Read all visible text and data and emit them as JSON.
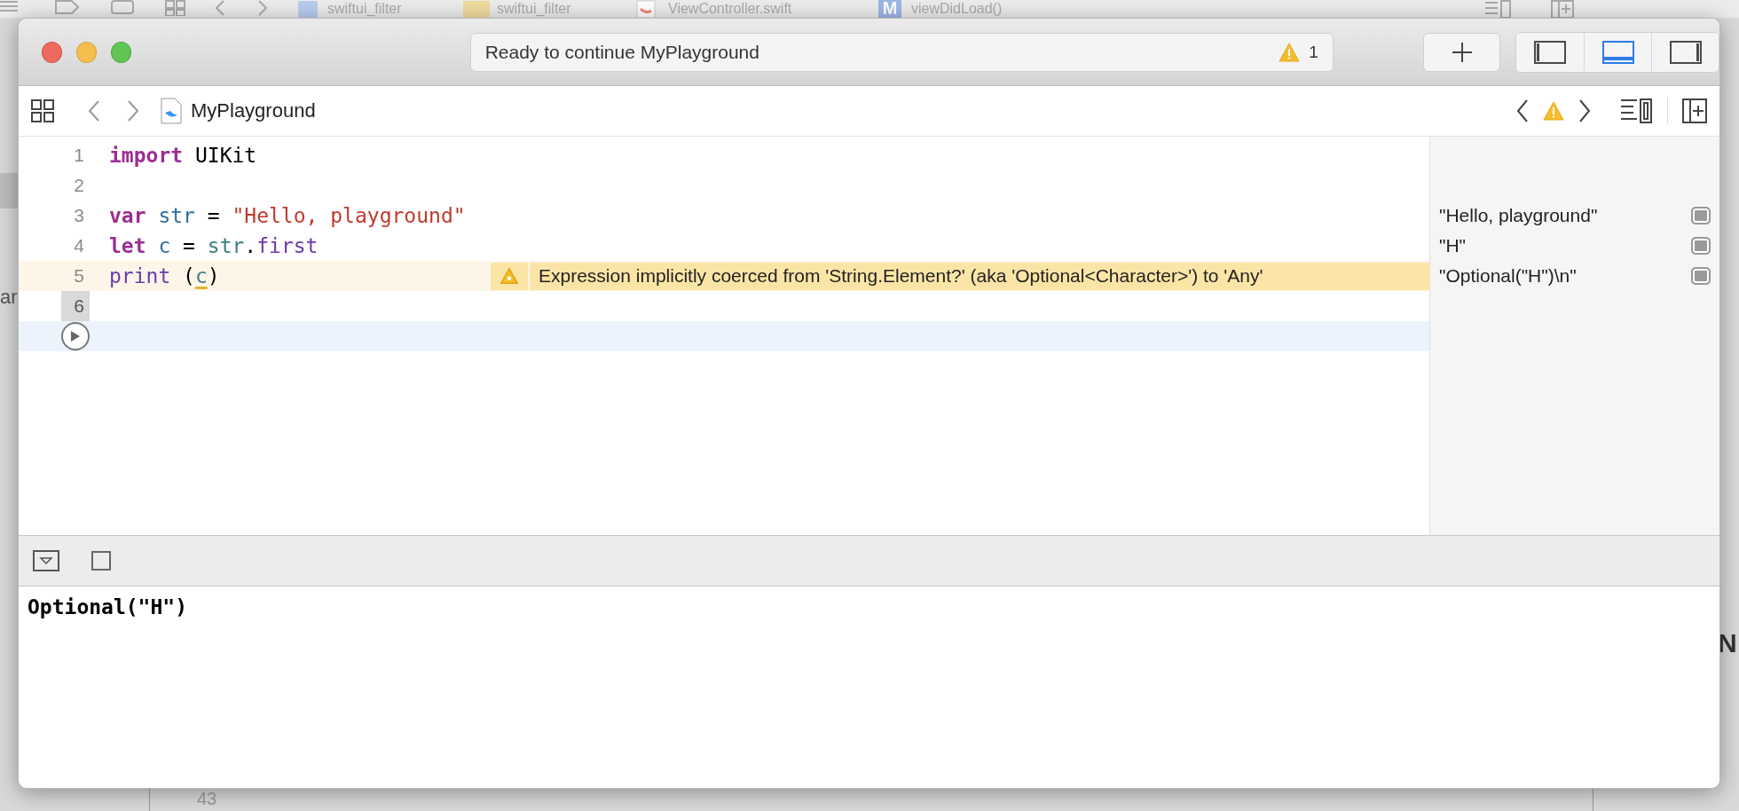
{
  "background": {
    "breadcrumbs": [
      "swiftui_filter",
      "swiftui_filter",
      "ViewController.swift",
      "viewDidLoad()"
    ],
    "method_badge": "M",
    "side_text": "ar",
    "line_number": "43",
    "edge_text": "N"
  },
  "window": {
    "status": "Ready to continue MyPlayground",
    "warning_count": "1",
    "panels": [
      {
        "selected": false
      },
      {
        "selected": true
      },
      {
        "selected": false
      }
    ]
  },
  "jump_bar": {
    "title": "MyPlayground"
  },
  "editor": {
    "lines": [
      {
        "kind": "code",
        "number": "1",
        "selected": false,
        "current": false,
        "tokens": [
          {
            "kind": "keyword",
            "text": "import"
          },
          {
            "kind": "plain",
            "text": " UIKit"
          }
        ]
      },
      {
        "kind": "code",
        "number": "2",
        "selected": false,
        "current": false
      },
      {
        "kind": "code",
        "number": "3",
        "selected": false,
        "current": false,
        "tokens": [
          {
            "kind": "keyword",
            "text": "var"
          },
          {
            "kind": "declaration",
            "text": " str"
          },
          {
            "kind": "plain",
            "text": " = "
          },
          {
            "kind": "string",
            "text": "\"Hello, playground\""
          }
        ],
        "result": "\"Hello, playground\""
      },
      {
        "kind": "code",
        "number": "4",
        "selected": false,
        "current": false,
        "tokens": [
          {
            "kind": "keyword",
            "text": "let"
          },
          {
            "kind": "declaration",
            "text": " c"
          },
          {
            "kind": "plain",
            "text": " = "
          },
          {
            "kind": "reference",
            "text": "str"
          },
          {
            "kind": "plain",
            "text": "."
          },
          {
            "kind": "function",
            "text": "first"
          }
        ],
        "result": "\"H\""
      },
      {
        "kind": "code",
        "number": "5",
        "selected": false,
        "current": false,
        "tokens": [
          {
            "kind": "function",
            "text": "print"
          },
          {
            "kind": "plain",
            "text": " ("
          },
          {
            "kind": "flagged",
            "text": "c"
          },
          {
            "kind": "plain",
            "text": ")"
          }
        ],
        "warning": "Expression implicitly coerced from 'String.Element?' (aka 'Optional<Character>') to 'Any'",
        "result": "\"Optional(\"H\")\\n\""
      },
      {
        "kind": "code",
        "number": "6",
        "selected": true,
        "current": false
      },
      {
        "kind": "run",
        "selected": false,
        "current": true
      }
    ]
  },
  "console": {
    "output": "Optional(\"H\")"
  }
}
